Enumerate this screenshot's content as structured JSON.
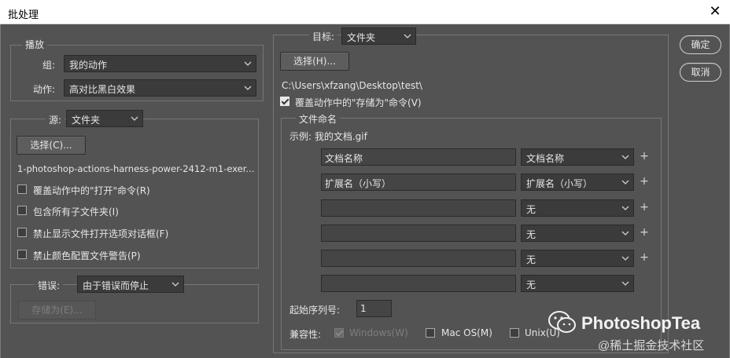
{
  "window": {
    "title": "批处理"
  },
  "buttons": {
    "ok": "确定",
    "cancel": "取消"
  },
  "play": {
    "legend": "播放",
    "set_label": "组:",
    "set_value": "我的动作",
    "action_label": "动作:",
    "action_value": "高对比黑白效果"
  },
  "source": {
    "label": "源:",
    "value": "文件夹",
    "choose": "选择(C)...",
    "path": "1-photoshop-actions-harness-power-2412-m1-exer...",
    "options": [
      "覆盖动作中的\"打开\"命令(R)",
      "包含所有子文件夹(I)",
      "禁止显示文件打开选项对话框(F)",
      "禁止颜色配置文件警告(P)"
    ]
  },
  "errors": {
    "label": "错误:",
    "value": "由于错误而停止",
    "save_as": "存储为(E)..."
  },
  "destination": {
    "label": "目标:",
    "value": "文件夹",
    "choose": "选择(H)...",
    "path": "C:\\Users\\xfzang\\Desktop\\test\\",
    "override": "覆盖动作中的\"存储为\"命令(V)"
  },
  "naming": {
    "legend": "文件命名",
    "example": "示例: 我的文档.gif",
    "rows": [
      {
        "text": "文档名称",
        "select": "文档名称",
        "plus": "+"
      },
      {
        "text": "扩展名（小写）",
        "select": "扩展名（小写）",
        "plus": "+"
      },
      {
        "text": "",
        "select": "无",
        "plus": "+"
      },
      {
        "text": "",
        "select": "无",
        "plus": "+"
      },
      {
        "text": "",
        "select": "无",
        "plus": "+"
      },
      {
        "text": "",
        "select": "无",
        "plus": ""
      }
    ],
    "serial_label": "起始序列号:",
    "serial_value": "1",
    "compat_label": "兼容性:",
    "compat": {
      "windows": "Windows(W)",
      "mac": "Mac OS(M)",
      "unix": "Unix(U)"
    }
  },
  "watermark": {
    "brand": "PhotoshopTea",
    "site": "@稀土掘金技术社区"
  },
  "icons": {
    "dropdown": "chevron-down-icon",
    "close": "close-icon",
    "checkbox": "checkbox-icon",
    "wechat": "wechat-icon"
  }
}
